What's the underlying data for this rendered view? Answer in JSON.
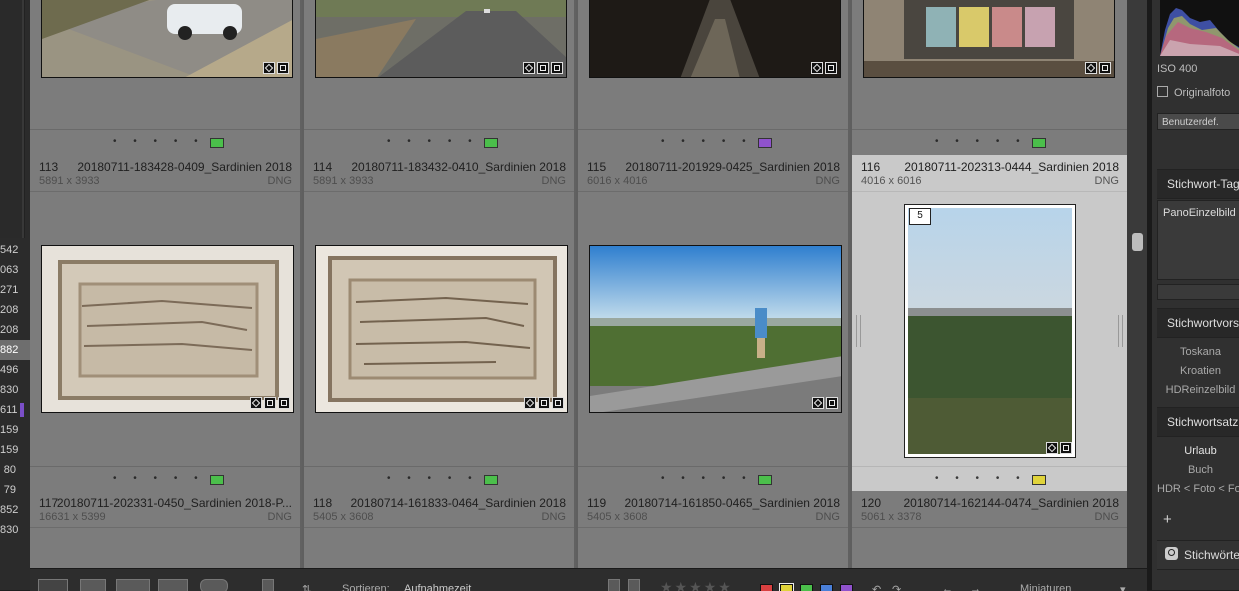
{
  "left_panel": {
    "numbers": [
      "542",
      "063",
      "271",
      "208",
      "208",
      "882",
      "496",
      "830",
      "611",
      "159",
      "159",
      "80",
      "79",
      "852",
      "830"
    ],
    "selected_index": 5,
    "colored_mark_index": 8,
    "colored_mark_color": "#7b4fc8"
  },
  "grid": {
    "top_row": [
      {
        "label_color": "#4bbf4b"
      },
      {
        "label_color": "#4bbf4b"
      },
      {
        "label_color": "#8f52cc"
      },
      {
        "label_color": "#4bbf4b"
      }
    ],
    "header_row": [
      {
        "index": "113",
        "filename": "20180711-183428-0409_Sardinien 2018",
        "dims": "5891 x 3933",
        "format": "DNG"
      },
      {
        "index": "114",
        "filename": "20180711-183432-0410_Sardinien 2018",
        "dims": "5891 x 3933",
        "format": "DNG"
      },
      {
        "index": "115",
        "filename": "20180711-201929-0425_Sardinien 2018",
        "dims": "6016 x 4016",
        "format": "DNG"
      },
      {
        "index": "116",
        "filename": "20180711-202313-0444_Sardinien 2018",
        "dims": "4016 x 6016",
        "format": "DNG"
      }
    ],
    "middle_row": [
      {
        "label_color": "#4bbf4b"
      },
      {
        "label_color": "#4bbf4b"
      },
      {
        "label_color": "#4bbf4b"
      },
      {
        "label_color": "#e0d33a",
        "stack_count": "5"
      }
    ],
    "bottom_row": [
      {
        "index": "117",
        "filename": "20180711-202331-0450_Sardinien 2018-P...",
        "dims": "16631 x 5399",
        "format": "DNG"
      },
      {
        "index": "118",
        "filename": "20180714-161833-0464_Sardinien 2018",
        "dims": "5405 x 3608",
        "format": "DNG"
      },
      {
        "index": "119",
        "filename": "20180714-161850-0465_Sardinien 2018",
        "dims": "5405 x 3608",
        "format": "DNG"
      },
      {
        "index": "120",
        "filename": "20180714-162144-0474_Sardinien 2018",
        "dims": "5061 x 3378",
        "format": "DNG"
      }
    ],
    "rating_dots": "• • • • •",
    "thumbnail_icons": [
      "keyword-badge-icon",
      "crop-badge-icon",
      "develop-badge-icon"
    ]
  },
  "right_panel": {
    "iso": "ISO 400",
    "original_photo_label": "Originalfoto",
    "preset": "Benutzerdef.",
    "keyword_tags_header": "Stichwort-Tags",
    "keyword_tags_value": "PanoEinzelbild",
    "keyword_suggestions_header": "Stichwortvorschläge",
    "suggestions": [
      "Toskana",
      "Kroatien",
      "HDReinzelbild"
    ],
    "keyword_set_header": "Stichwortsatz",
    "keyword_set": [
      "Urlaub",
      "Buch",
      "HDR < Foto < Foto"
    ],
    "plus_label": "+",
    "keyword_list_header": "Stichwörter"
  },
  "toolbar": {
    "sort_label": "Sortieren:",
    "sort_value": "Aufnahmezeit",
    "stars": "★★★★★",
    "color_labels": [
      "#d94040",
      "#e0d33a",
      "#4bbf4b",
      "#4a7fd8",
      "#8f52cc"
    ],
    "thumbnails_label": "Miniaturen"
  }
}
